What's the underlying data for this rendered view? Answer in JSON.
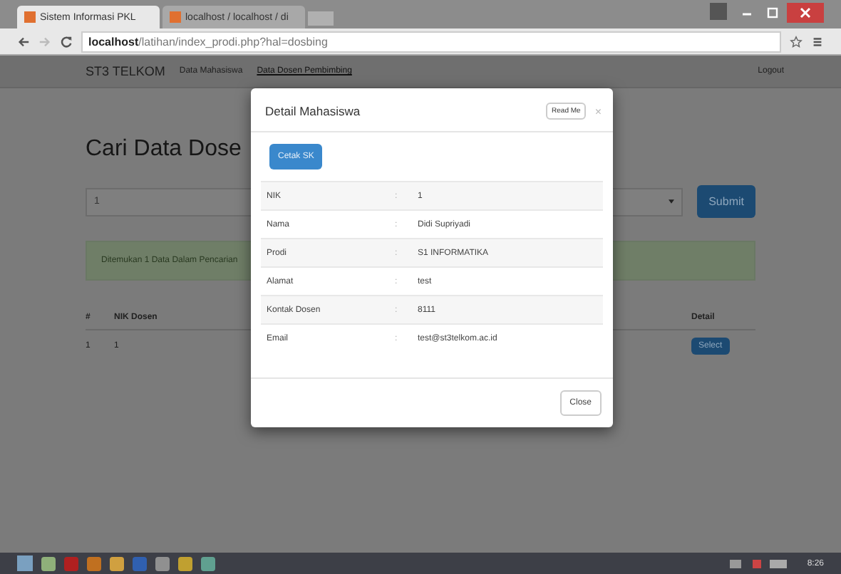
{
  "browser": {
    "tabs": [
      {
        "title": "Sistem Informasi PKL",
        "selected": true
      },
      {
        "title": "localhost / localhost / di",
        "selected": false
      }
    ],
    "url_host": "localhost",
    "url_path": "/latihan/index_prodi.php?hal=dosbing"
  },
  "navbar": {
    "brand": "ST3 TELKOM",
    "links": [
      {
        "label": "Data Mahasiswa",
        "selected": false
      },
      {
        "label": "Data Dosen Pembimbing",
        "selected": true
      }
    ],
    "logout": "Logout"
  },
  "page": {
    "heading": "Cari Data Dose",
    "search_value": "1",
    "submit": "Submit",
    "alert": "Ditemukan 1 Data Dalam Pencarian",
    "table": {
      "columns": [
        "#",
        "NIK Dosen"
      ],
      "detail_column": "Detail",
      "rows": [
        {
          "cells": [
            "1",
            "1"
          ],
          "action": "Select"
        }
      ]
    }
  },
  "modal": {
    "title": "Detail Mahasiswa",
    "read_me": "Read Me",
    "close_icon": "×",
    "print_button": "Cetak SK",
    "rows": [
      {
        "label": "NIK",
        "sep": ":",
        "value": "1"
      },
      {
        "label": "Nama",
        "sep": ":",
        "value": "Didi Supriyadi"
      },
      {
        "label": "Prodi",
        "sep": ":",
        "value": "S1 INFORMATIKA"
      },
      {
        "label": "Alamat",
        "sep": ":",
        "value": "test"
      },
      {
        "label": "Kontak Dosen",
        "sep": ":",
        "value": "8111"
      },
      {
        "label": "Email",
        "sep": ":",
        "value": "test@st3telkom.ac.id"
      }
    ],
    "close_button": "Close"
  },
  "taskbar": {
    "clock": "8:26"
  }
}
